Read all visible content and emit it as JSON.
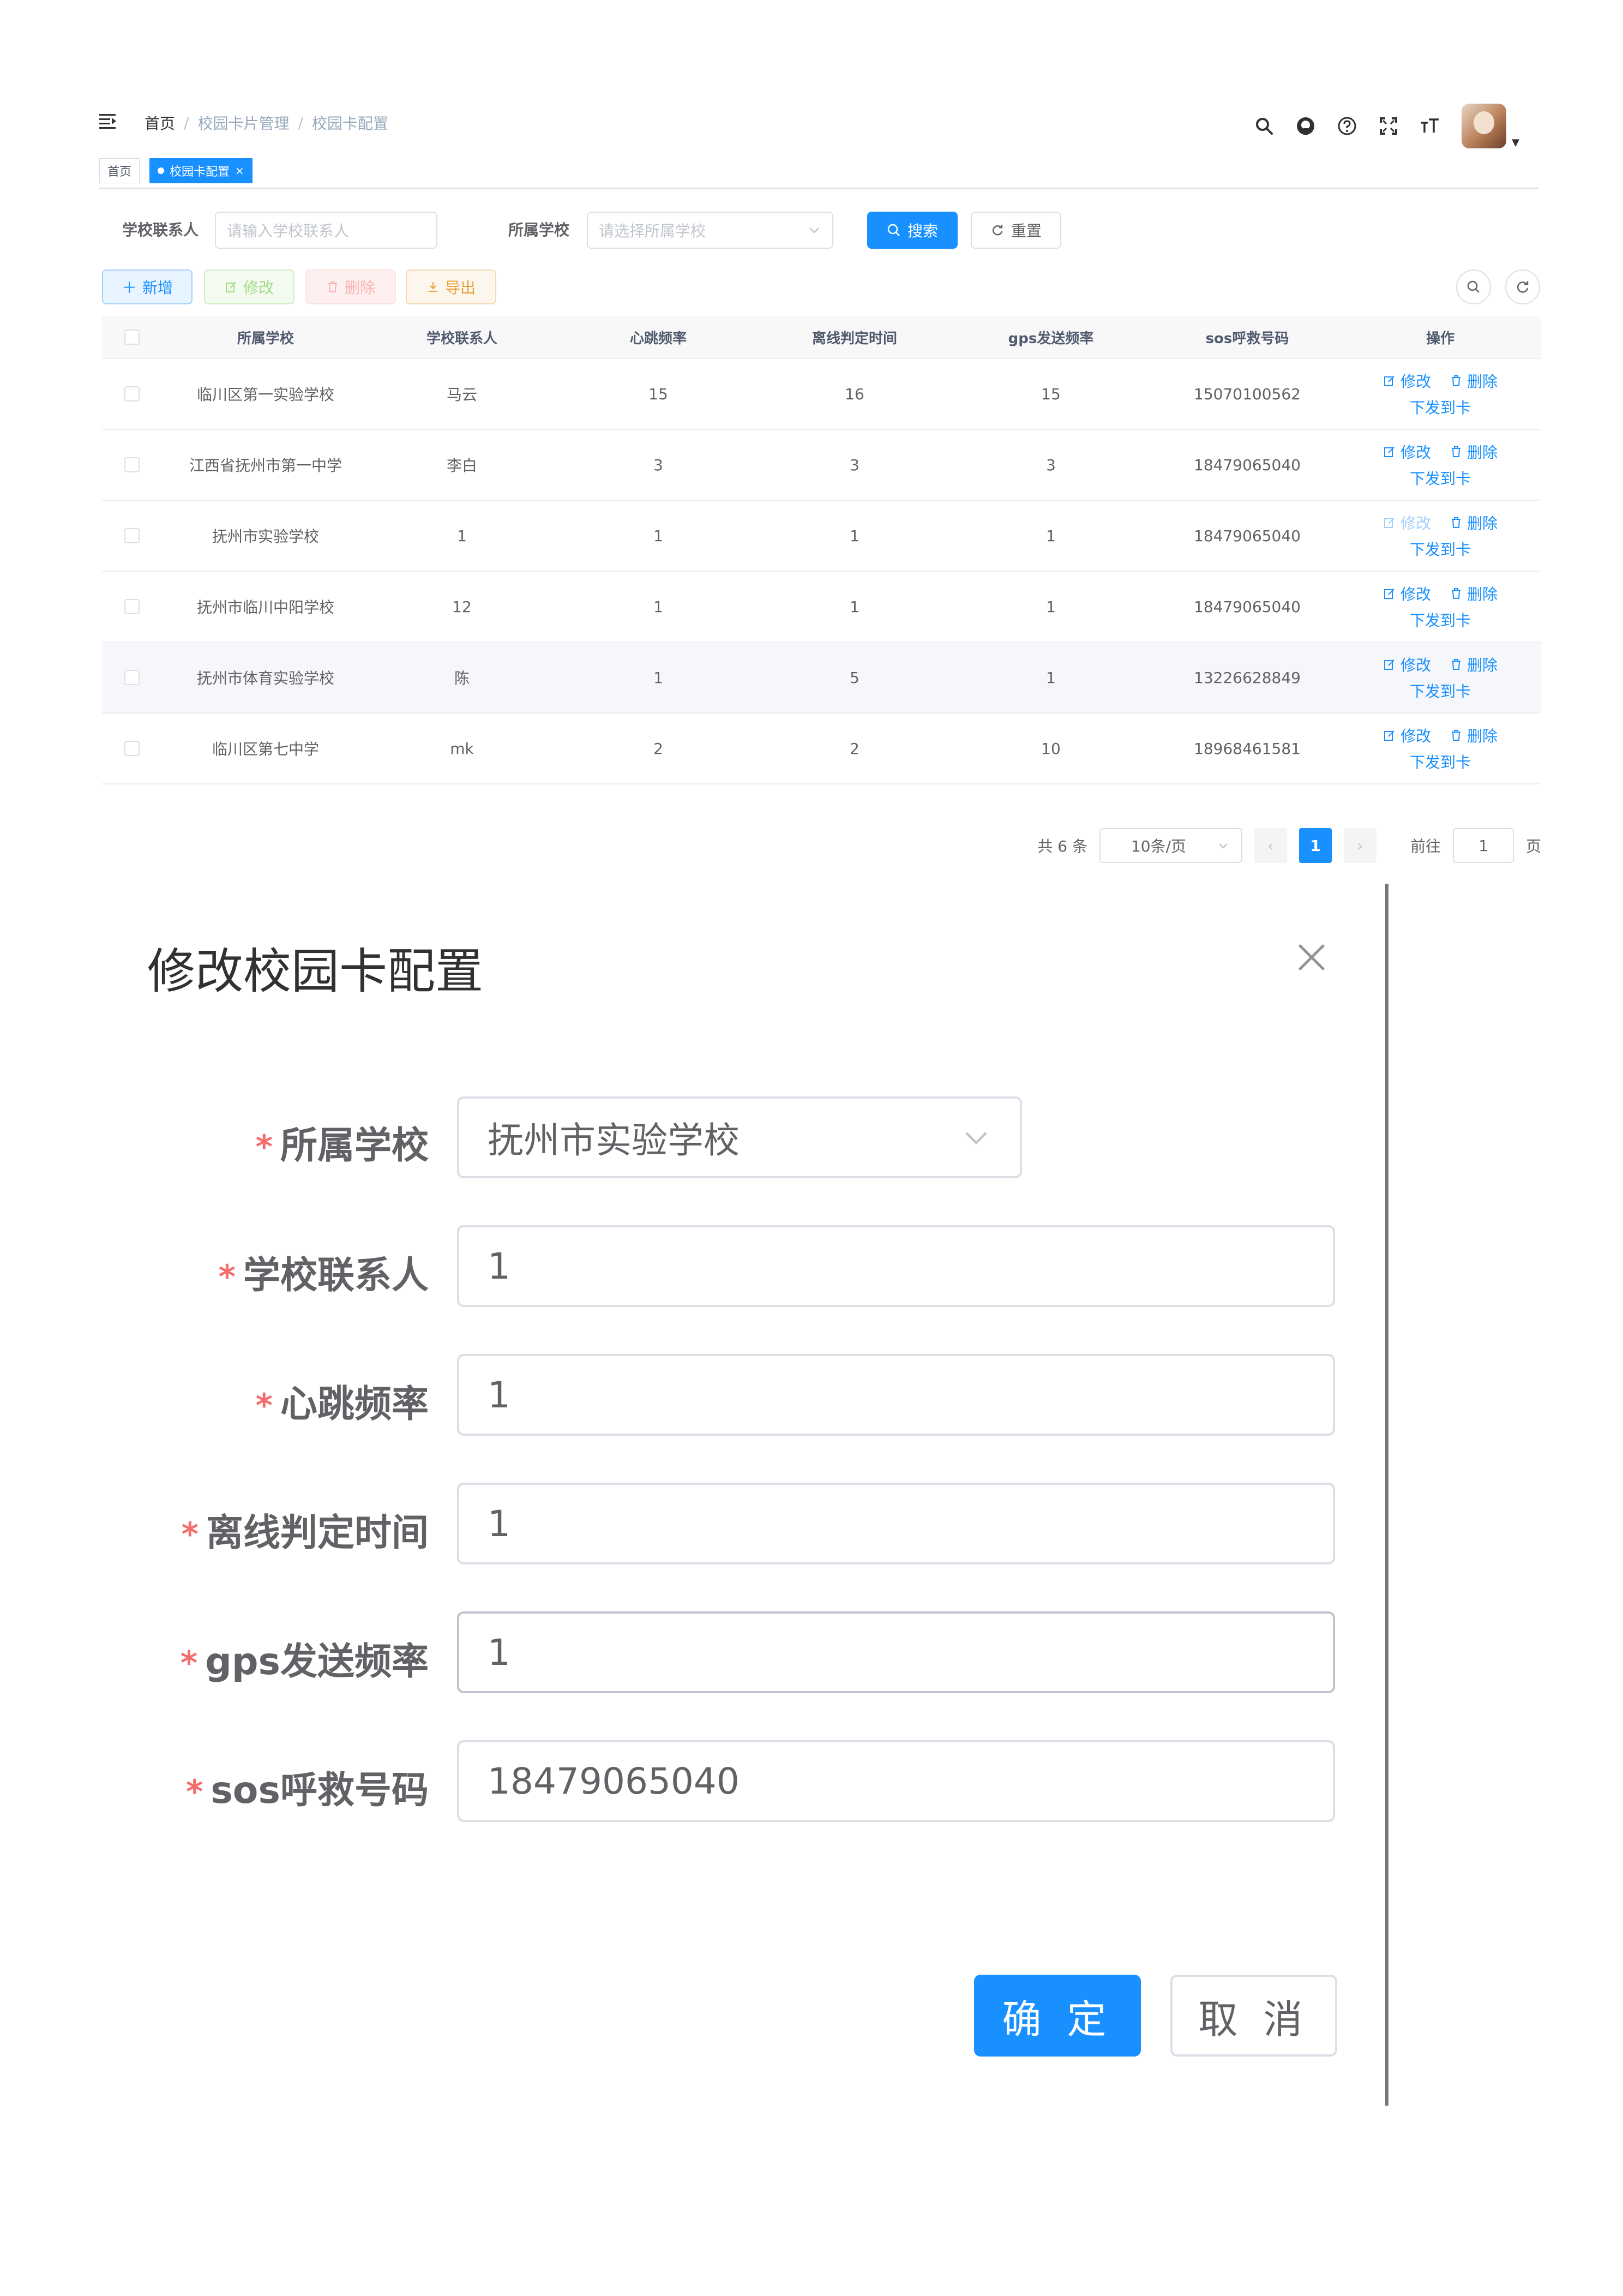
{
  "navbar": {
    "breadcrumb": [
      "首页",
      "校园卡片管理",
      "校园卡配置"
    ],
    "breadcrumb_separator": "/",
    "icons": [
      "search-icon",
      "github-icon",
      "help-icon",
      "fullscreen-icon",
      "font-size-icon"
    ]
  },
  "tags": {
    "home": "首页",
    "active": "校园卡配置",
    "close": "×"
  },
  "search_form": {
    "contact_label": "学校联系人",
    "contact_placeholder": "请输入学校联系人",
    "school_label": "所属学校",
    "school_placeholder": "请选择所属学校",
    "search_button": "搜索",
    "reset_button": "重置"
  },
  "toolbar": {
    "add": "新增",
    "edit": "修改",
    "delete": "删除",
    "export": "导出"
  },
  "table": {
    "columns": [
      "所属学校",
      "学校联系人",
      "心跳频率",
      "离线判定时间",
      "gps发送频率",
      "sos呼救号码",
      "操作"
    ],
    "actions": {
      "edit": "修改",
      "delete": "删除",
      "issue": "下发到卡"
    },
    "rows": [
      {
        "school": "临川区第一实验学校",
        "contact": "马云",
        "heartbeat": "15",
        "offline": "16",
        "gps": "15",
        "sos": "15070100562"
      },
      {
        "school": "江西省抚州市第一中学",
        "contact": "李白",
        "heartbeat": "3",
        "offline": "3",
        "gps": "3",
        "sos": "18479065040"
      },
      {
        "school": "抚州市实验学校",
        "contact": "1",
        "heartbeat": "1",
        "offline": "1",
        "gps": "1",
        "sos": "18479065040"
      },
      {
        "school": "抚州市临川中阳学校",
        "contact": "12",
        "heartbeat": "1",
        "offline": "1",
        "gps": "1",
        "sos": "18479065040"
      },
      {
        "school": "抚州市体育实验学校",
        "contact": "陈",
        "heartbeat": "1",
        "offline": "5",
        "gps": "1",
        "sos": "13226628849"
      },
      {
        "school": "临川区第七中学",
        "contact": "mk",
        "heartbeat": "2",
        "offline": "2",
        "gps": "10",
        "sos": "18968461581"
      }
    ]
  },
  "pagination": {
    "total": "共 6 条",
    "page_size": "10条/页",
    "current_page": "1",
    "goto_label": "前往",
    "goto_value": "1",
    "page_suffix": "页"
  },
  "dialog": {
    "title": "修改校园卡配置",
    "fields": {
      "school": {
        "label": "所属学校",
        "value": "抚州市实验学校"
      },
      "contact": {
        "label": "学校联系人",
        "value": "1"
      },
      "heartbeat": {
        "label": "心跳频率",
        "value": "1"
      },
      "offline": {
        "label": "离线判定时间",
        "value": "1"
      },
      "gps": {
        "label": "gps发送频率",
        "value": "1"
      },
      "sos": {
        "label": "sos呼救号码",
        "value": "18479065040"
      }
    },
    "required_mark": "*",
    "confirm": "确 定",
    "cancel": "取 消"
  },
  "colors": {
    "primary": "#1890ff",
    "danger": "#f56c6c",
    "success": "#67c23a",
    "warning": "#e6a23c",
    "border": "#dcdfe6"
  }
}
